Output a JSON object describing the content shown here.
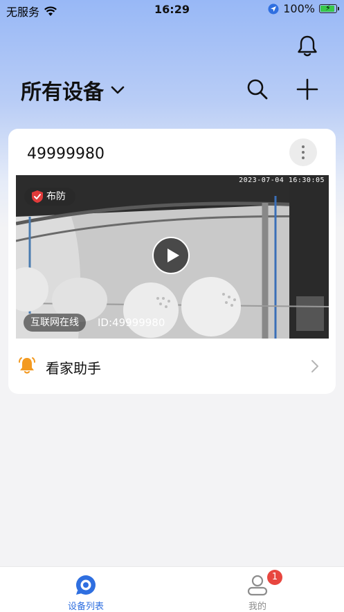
{
  "status_bar": {
    "carrier": "无服务",
    "time": "16:29",
    "battery_text": "100%"
  },
  "header": {
    "title": "所有设备"
  },
  "device": {
    "name": "49999980",
    "arm_status": "布防",
    "timestamp": "2023-07-04 16:30:05",
    "connection": "互联网在线",
    "id_text": "ID:49999980"
  },
  "helper": {
    "label": "看家助手"
  },
  "tabs": [
    {
      "label": "设备列表",
      "active": true
    },
    {
      "label": "我的",
      "active": false,
      "badge": "1"
    }
  ],
  "colors": {
    "accent": "#2f6fe0",
    "badge": "#e8463f",
    "bell_orange": "#f39a21",
    "inactive": "#8c8c8c"
  }
}
